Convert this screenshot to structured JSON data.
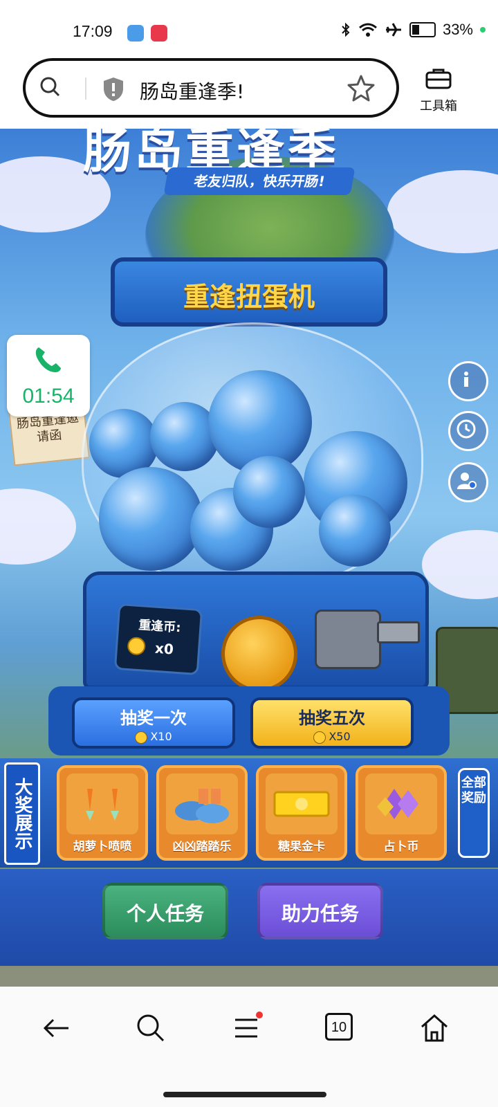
{
  "status": {
    "time": "17:09",
    "battery": "33%",
    "battery_level": 0.33
  },
  "browser": {
    "page_title": "肠岛重逢季!",
    "toolbox_label": "工具箱"
  },
  "game": {
    "hero_title": "肠岛重逢季",
    "subtitle": "老友归队，快乐开肠!",
    "machine_title": "重逢扭蛋机",
    "invite_card": "肠岛重逢邀请函",
    "coin_label": "重逢币:",
    "coin_count": "x0",
    "draw_once": {
      "label": "抽奖一次",
      "cost": "X10"
    },
    "draw_five": {
      "label": "抽奖五次",
      "cost": "X50"
    },
    "prize_section_label": "大奖展示",
    "prizes": [
      {
        "name": "胡萝卜喷喷"
      },
      {
        "name": "凶凶踏踏乐"
      },
      {
        "name": "糖果金卡"
      },
      {
        "name": "占卜币"
      }
    ],
    "all_rewards": "全部奖励",
    "personal_task": "个人任务",
    "assist_task": "助力任务"
  },
  "call": {
    "timer": "01:54"
  },
  "nav": {
    "tab_count": "10"
  },
  "colors": {
    "call_green": "#18b368",
    "accent_blue": "#2a6fe0",
    "gold": "#f2b21a"
  }
}
